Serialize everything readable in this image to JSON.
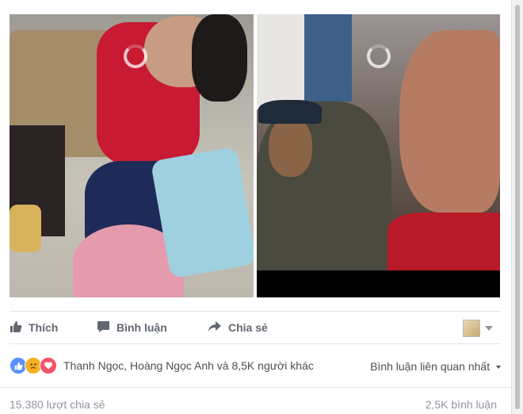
{
  "post": {
    "actions": {
      "like_label": "Thích",
      "comment_label": "Bình luận",
      "share_label": "Chia sẻ"
    },
    "reactions": {
      "icons": [
        "like-reaction",
        "sad-reaction",
        "love-reaction"
      ],
      "names_text": "Thanh Ngọc, Hoàng Ngọc Anh và 8,5K người khác"
    },
    "comment_sort": "Bình luận liên quan nhất",
    "shares_text": "15.380 lượt chia sẻ",
    "comments_text": "2,5K bình luận"
  },
  "colors": {
    "like_blue": "#5890ff",
    "sad_yellow": "#f7b125",
    "love_red": "#f25268",
    "action_gray": "#606770"
  }
}
